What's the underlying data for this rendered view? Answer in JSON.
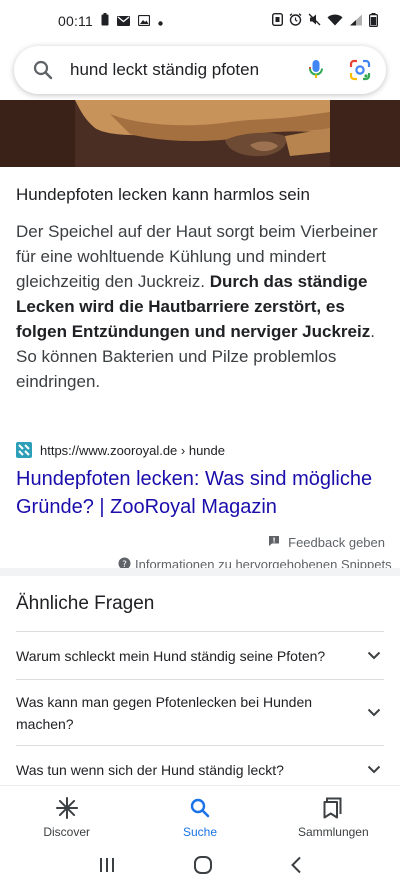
{
  "status_bar": {
    "time": "00:11",
    "left_icons": [
      "battery-saver-icon",
      "mail-icon",
      "image-icon",
      "dot-icon"
    ],
    "right_icons": [
      "nfc-icon",
      "alarm-icon",
      "mute-icon",
      "wifi-icon",
      "signal-icon",
      "battery-icon"
    ]
  },
  "search": {
    "query": "hund leckt ständig pfoten"
  },
  "snippet": {
    "heading": "Hundepfoten lecken kann harmlos sein",
    "text_1": "Der Speichel auf der Haut sorgt beim Vierbeiner für eine wohltuende Kühlung und mindert gleichzeitig den Juckreiz. ",
    "text_bold": "Durch das ständige Lecken wird die Hautbarriere zerstört, es folgen Entzündungen und nerviger Juckreiz",
    "text_2": ". So können Bakterien und Pilze problemlos eindringen."
  },
  "source": {
    "url": "https://www.zooroyal.de › hunde",
    "title": "Hundepfoten lecken: Was sind mögliche Gründe? | ZooRoyal Magazin"
  },
  "feedback": {
    "feedback_label": "Feedback geben",
    "info_label": "Informationen zu hervorgehobenen Snippets"
  },
  "paa": {
    "title": "Ähnliche Fragen",
    "questions": [
      "Warum schleckt mein Hund ständig seine Pfoten?",
      "Was kann man gegen Pfotenlecken bei Hunden machen?",
      "Was tun wenn sich der Hund ständig leckt?"
    ]
  },
  "bottom_nav": {
    "items": [
      {
        "label": "Discover",
        "icon": "discover-icon"
      },
      {
        "label": "Suche",
        "icon": "search-icon",
        "active": true
      },
      {
        "label": "Sammlungen",
        "icon": "collections-icon"
      }
    ]
  },
  "colors": {
    "link": "#1a0dab",
    "accent": "#1a73e8",
    "hero_background": "#4a2e23"
  }
}
